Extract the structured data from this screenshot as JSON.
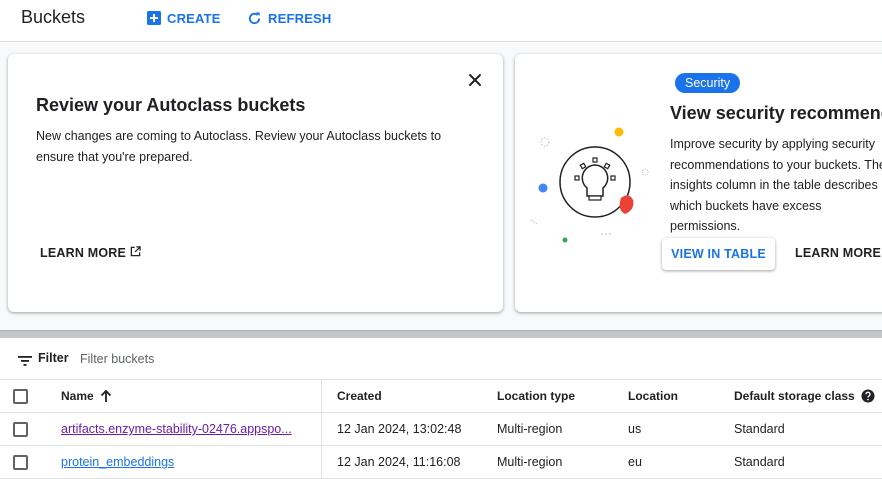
{
  "header": {
    "title": "Buckets",
    "create_label": "CREATE",
    "refresh_label": "REFRESH"
  },
  "autoclass_card": {
    "title": "Review your Autoclass buckets",
    "body": "New changes are coming to Autoclass. Review your Autoclass buckets to ensure that you're prepared.",
    "learn_more_label": "LEARN MORE"
  },
  "security_card": {
    "badge": "Security",
    "title": "View security recommendations",
    "body": "Improve security by applying security recommendations to your buckets. The insights column in the table describes which buckets have excess permissions.",
    "view_in_table_label": "VIEW IN TABLE",
    "learn_more_label": "LEARN MORE"
  },
  "filter": {
    "label": "Filter",
    "placeholder": "Filter buckets"
  },
  "table": {
    "columns": {
      "name": "Name",
      "created": "Created",
      "location_type": "Location type",
      "location": "Location",
      "storage_class": "Default storage class"
    },
    "rows": [
      {
        "name": "artifacts.enzyme-stability-02476.appspo...",
        "created": "12 Jan 2024, 13:02:48",
        "location_type": "Multi-region",
        "location": "us",
        "storage_class": "Standard"
      },
      {
        "name": "protein_embeddings",
        "created": "12 Jan 2024, 11:16:08",
        "location_type": "Multi-region",
        "location": "eu",
        "storage_class": "Standard"
      }
    ]
  },
  "colors": {
    "accent": "#1a73e8",
    "visited_link": "#681da8",
    "text": "#202124"
  },
  "icons": {
    "create": "add-box-icon",
    "refresh": "refresh-icon",
    "close": "close-icon",
    "external": "open-in-new-icon",
    "filter": "filter-list-icon",
    "sort": "arrow-upward-icon",
    "help": "help-icon",
    "security_illustration": "lightbulb-shield-illustration"
  }
}
